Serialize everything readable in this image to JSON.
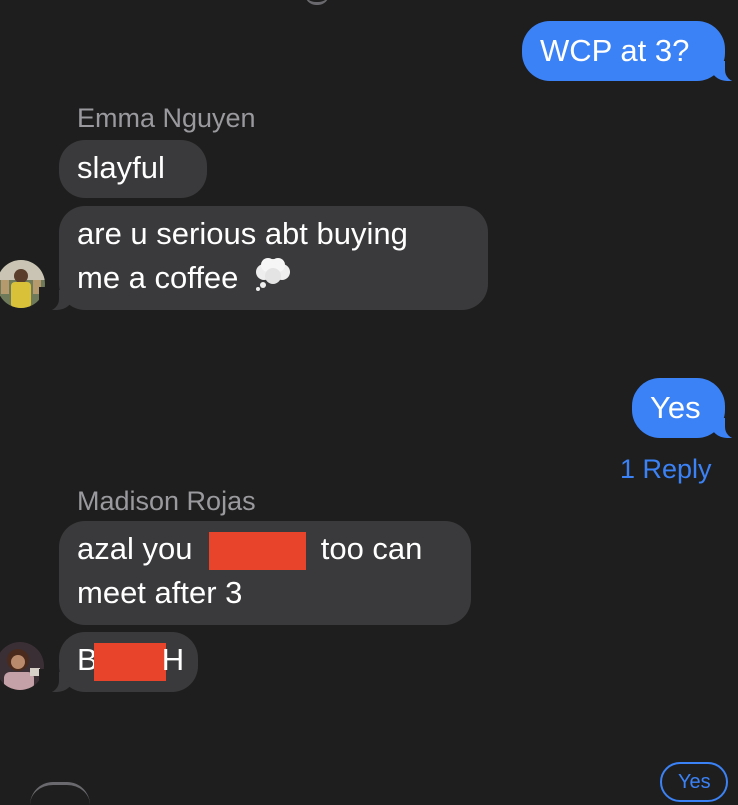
{
  "thread": {
    "messages": [
      {
        "id": "m1",
        "direction": "outgoing",
        "text": "WCP at 3?"
      },
      {
        "id": "m2",
        "direction": "incoming",
        "sender": "Emma Nguyen",
        "text": "slayful"
      },
      {
        "id": "m3",
        "direction": "incoming",
        "text_line1": "are u serious abt buying",
        "text_line2": "me a coffee",
        "emoji": "thought-balloon"
      },
      {
        "id": "m4",
        "direction": "outgoing",
        "text": "Yes"
      },
      {
        "id": "m5",
        "direction": "incoming",
        "sender": "Madison Rojas",
        "text_before": "azal you",
        "text_after": "too can",
        "text_line2": "meet after 3"
      },
      {
        "id": "m6",
        "direction": "incoming",
        "text_before": "B",
        "text_after": "H"
      }
    ],
    "reply_link": "1 Reply",
    "tapback_label": "Yes"
  },
  "colors": {
    "background": "#1e1e1e",
    "outgoing_bubble": "#3b82f6",
    "incoming_bubble": "#3a3a3c",
    "sender_name": "#9a9a9e",
    "link": "#3b82f6",
    "redaction": "#e8432b"
  }
}
